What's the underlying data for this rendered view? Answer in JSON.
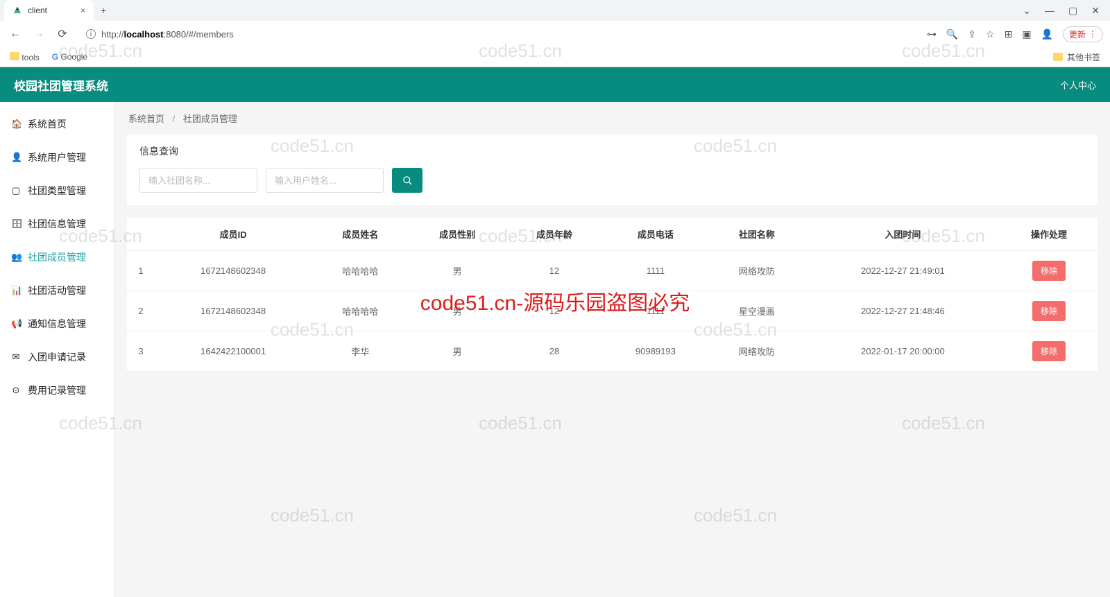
{
  "browser": {
    "tab_title": "client",
    "url_host": "localhost",
    "url_scheme": "http://",
    "url_port_path": ":8080/#/members",
    "bookmarks": {
      "tools": "tools",
      "google": "Google",
      "other": "其他书签"
    },
    "update": "更新"
  },
  "app": {
    "title": "校园社团管理系统",
    "personal_center": "个人中心"
  },
  "sidebar": {
    "items": [
      {
        "icon": "🏠",
        "label": "系统首页"
      },
      {
        "icon": "👤",
        "label": "系统用户管理"
      },
      {
        "icon": "▢",
        "label": "社团类型管理"
      },
      {
        "icon": "🗄",
        "label": "社团信息管理"
      },
      {
        "icon": "👥",
        "label": "社团成员管理"
      },
      {
        "icon": "📊",
        "label": "社团活动管理"
      },
      {
        "icon": "📢",
        "label": "通知信息管理"
      },
      {
        "icon": "✉",
        "label": "入团申请记录"
      },
      {
        "icon": "⊙",
        "label": "费用记录管理"
      }
    ]
  },
  "breadcrumb": {
    "root": "系统首页",
    "current": "社团成员管理"
  },
  "search": {
    "title": "信息查询",
    "placeholder_club": "输入社团名称...",
    "placeholder_user": "输入用户姓名..."
  },
  "table": {
    "headers": [
      "",
      "成员ID",
      "成员姓名",
      "成员性别",
      "成员年龄",
      "成员电话",
      "社团名称",
      "入团时间",
      "操作处理"
    ],
    "rows": [
      {
        "idx": "1",
        "id": "1672148602348",
        "name": "哈哈哈哈",
        "gender": "男",
        "age": "12",
        "phone": "1111",
        "club": "网络攻防",
        "time": "2022-12-27 21:49:01"
      },
      {
        "idx": "2",
        "id": "1672148602348",
        "name": "哈哈哈哈",
        "gender": "男",
        "age": "12",
        "phone": "1111",
        "club": "星空漫画",
        "time": "2022-12-27 21:48:46"
      },
      {
        "idx": "3",
        "id": "1642422100001",
        "name": "李华",
        "gender": "男",
        "age": "28",
        "phone": "90989193",
        "club": "网络攻防",
        "time": "2022-01-17 20:00:00"
      }
    ],
    "delete_label": "移除"
  },
  "watermark": {
    "main": "code51.cn-源码乐园盗图必究",
    "light": "code51.cn"
  }
}
